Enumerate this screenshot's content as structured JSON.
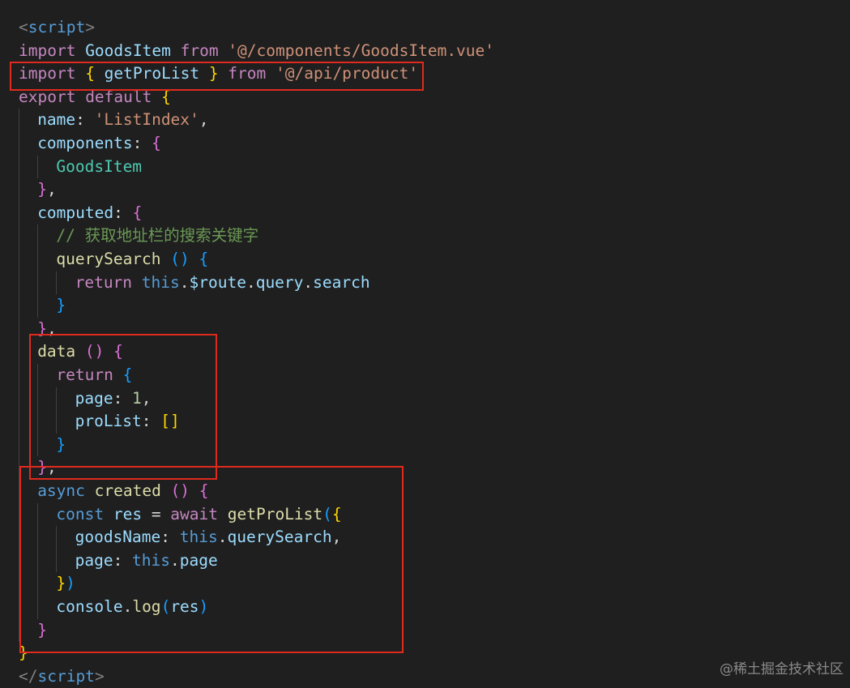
{
  "lines": [
    {
      "indent": 0,
      "tokens": [
        {
          "t": "<",
          "c": "t-punc"
        },
        {
          "t": "script",
          "c": "t-tag"
        },
        {
          "t": ">",
          "c": "t-punc"
        }
      ]
    },
    {
      "indent": 0,
      "tokens": [
        {
          "t": "import ",
          "c": "t-kw"
        },
        {
          "t": "GoodsItem ",
          "c": "t-prop"
        },
        {
          "t": "from ",
          "c": "t-kw"
        },
        {
          "t": "'@/components/GoodsItem.vue'",
          "c": "t-str"
        }
      ]
    },
    {
      "indent": 0,
      "tokens": [
        {
          "t": "import ",
          "c": "t-kw"
        },
        {
          "t": "{ ",
          "c": "t-b1"
        },
        {
          "t": "getProList ",
          "c": "t-prop"
        },
        {
          "t": "} ",
          "c": "t-b1"
        },
        {
          "t": "from ",
          "c": "t-kw"
        },
        {
          "t": "'@/api/product'",
          "c": "t-str"
        }
      ]
    },
    {
      "indent": 0,
      "tokens": [
        {
          "t": "export ",
          "c": "t-kw"
        },
        {
          "t": "default ",
          "c": "t-kw"
        },
        {
          "t": "{",
          "c": "t-b1"
        }
      ]
    },
    {
      "indent": 1,
      "tokens": [
        {
          "t": "name",
          "c": "t-prop"
        },
        {
          "t": ": ",
          "c": "t-plain"
        },
        {
          "t": "'ListIndex'",
          "c": "t-str"
        },
        {
          "t": ",",
          "c": "t-plain"
        }
      ]
    },
    {
      "indent": 1,
      "tokens": [
        {
          "t": "components",
          "c": "t-prop"
        },
        {
          "t": ": ",
          "c": "t-plain"
        },
        {
          "t": "{",
          "c": "t-b2"
        }
      ]
    },
    {
      "indent": 2,
      "tokens": [
        {
          "t": "GoodsItem",
          "c": "t-cls"
        }
      ]
    },
    {
      "indent": 1,
      "tokens": [
        {
          "t": "}",
          "c": "t-b2"
        },
        {
          "t": ",",
          "c": "t-plain"
        }
      ]
    },
    {
      "indent": 1,
      "tokens": [
        {
          "t": "computed",
          "c": "t-prop"
        },
        {
          "t": ": ",
          "c": "t-plain"
        },
        {
          "t": "{",
          "c": "t-b2"
        }
      ]
    },
    {
      "indent": 2,
      "tokens": [
        {
          "t": "// 获取地址栏的搜索关键字",
          "c": "t-com"
        }
      ]
    },
    {
      "indent": 2,
      "tokens": [
        {
          "t": "querySearch ",
          "c": "t-fn"
        },
        {
          "t": "() ",
          "c": "t-b3"
        },
        {
          "t": "{",
          "c": "t-b3"
        }
      ]
    },
    {
      "indent": 3,
      "tokens": [
        {
          "t": "return ",
          "c": "t-kw"
        },
        {
          "t": "this",
          "c": "t-this"
        },
        {
          "t": ".",
          "c": "t-plain"
        },
        {
          "t": "$route",
          "c": "t-prop"
        },
        {
          "t": ".",
          "c": "t-plain"
        },
        {
          "t": "query",
          "c": "t-prop"
        },
        {
          "t": ".",
          "c": "t-plain"
        },
        {
          "t": "search",
          "c": "t-prop"
        }
      ]
    },
    {
      "indent": 2,
      "tokens": [
        {
          "t": "}",
          "c": "t-b3"
        }
      ]
    },
    {
      "indent": 1,
      "tokens": [
        {
          "t": "}",
          "c": "t-b2"
        },
        {
          "t": ",",
          "c": "t-plain"
        }
      ]
    },
    {
      "indent": 1,
      "tokens": [
        {
          "t": "data ",
          "c": "t-fn"
        },
        {
          "t": "() ",
          "c": "t-b2"
        },
        {
          "t": "{",
          "c": "t-b2"
        }
      ]
    },
    {
      "indent": 2,
      "tokens": [
        {
          "t": "return ",
          "c": "t-kw"
        },
        {
          "t": "{",
          "c": "t-b3"
        }
      ]
    },
    {
      "indent": 3,
      "tokens": [
        {
          "t": "page",
          "c": "t-prop"
        },
        {
          "t": ": ",
          "c": "t-plain"
        },
        {
          "t": "1",
          "c": "t-num"
        },
        {
          "t": ",",
          "c": "t-plain"
        }
      ]
    },
    {
      "indent": 3,
      "tokens": [
        {
          "t": "proList",
          "c": "t-prop"
        },
        {
          "t": ": ",
          "c": "t-plain"
        },
        {
          "t": "[]",
          "c": "t-b1"
        }
      ]
    },
    {
      "indent": 2,
      "tokens": [
        {
          "t": "}",
          "c": "t-b3"
        }
      ]
    },
    {
      "indent": 1,
      "tokens": [
        {
          "t": "}",
          "c": "t-b2"
        },
        {
          "t": ",",
          "c": "t-plain"
        }
      ]
    },
    {
      "indent": 1,
      "tokens": [
        {
          "t": "async ",
          "c": "t-tag"
        },
        {
          "t": "created ",
          "c": "t-fn"
        },
        {
          "t": "() ",
          "c": "t-b2"
        },
        {
          "t": "{",
          "c": "t-b2"
        }
      ]
    },
    {
      "indent": 2,
      "tokens": [
        {
          "t": "const ",
          "c": "t-tag"
        },
        {
          "t": "res ",
          "c": "t-prop"
        },
        {
          "t": "= ",
          "c": "t-plain"
        },
        {
          "t": "await ",
          "c": "t-kw"
        },
        {
          "t": "getProList",
          "c": "t-fn"
        },
        {
          "t": "(",
          "c": "t-b3"
        },
        {
          "t": "{",
          "c": "t-b1"
        }
      ]
    },
    {
      "indent": 3,
      "tokens": [
        {
          "t": "goodsName",
          "c": "t-prop"
        },
        {
          "t": ": ",
          "c": "t-plain"
        },
        {
          "t": "this",
          "c": "t-this"
        },
        {
          "t": ".",
          "c": "t-plain"
        },
        {
          "t": "querySearch",
          "c": "t-prop"
        },
        {
          "t": ",",
          "c": "t-plain"
        }
      ]
    },
    {
      "indent": 3,
      "tokens": [
        {
          "t": "page",
          "c": "t-prop"
        },
        {
          "t": ": ",
          "c": "t-plain"
        },
        {
          "t": "this",
          "c": "t-this"
        },
        {
          "t": ".",
          "c": "t-plain"
        },
        {
          "t": "page",
          "c": "t-prop"
        }
      ]
    },
    {
      "indent": 2,
      "tokens": [
        {
          "t": "}",
          "c": "t-b1"
        },
        {
          "t": ")",
          "c": "t-b3"
        }
      ]
    },
    {
      "indent": 2,
      "tokens": [
        {
          "t": "console",
          "c": "t-prop"
        },
        {
          "t": ".",
          "c": "t-plain"
        },
        {
          "t": "log",
          "c": "t-fn"
        },
        {
          "t": "(",
          "c": "t-b3"
        },
        {
          "t": "res",
          "c": "t-prop"
        },
        {
          "t": ")",
          "c": "t-b3"
        }
      ]
    },
    {
      "indent": 1,
      "tokens": [
        {
          "t": "}",
          "c": "t-b2"
        }
      ]
    },
    {
      "indent": 0,
      "tokens": [
        {
          "t": "}",
          "c": "t-b1"
        }
      ]
    },
    {
      "indent": 0,
      "tokens": [
        {
          "t": "</",
          "c": "t-punc"
        },
        {
          "t": "script",
          "c": "t-tag"
        },
        {
          "t": ">",
          "c": "t-punc"
        }
      ]
    }
  ],
  "watermark": "@稀土掘金技术社区",
  "colors": {
    "background": "#1f1f1f",
    "highlight_box": "#e02a1e"
  }
}
